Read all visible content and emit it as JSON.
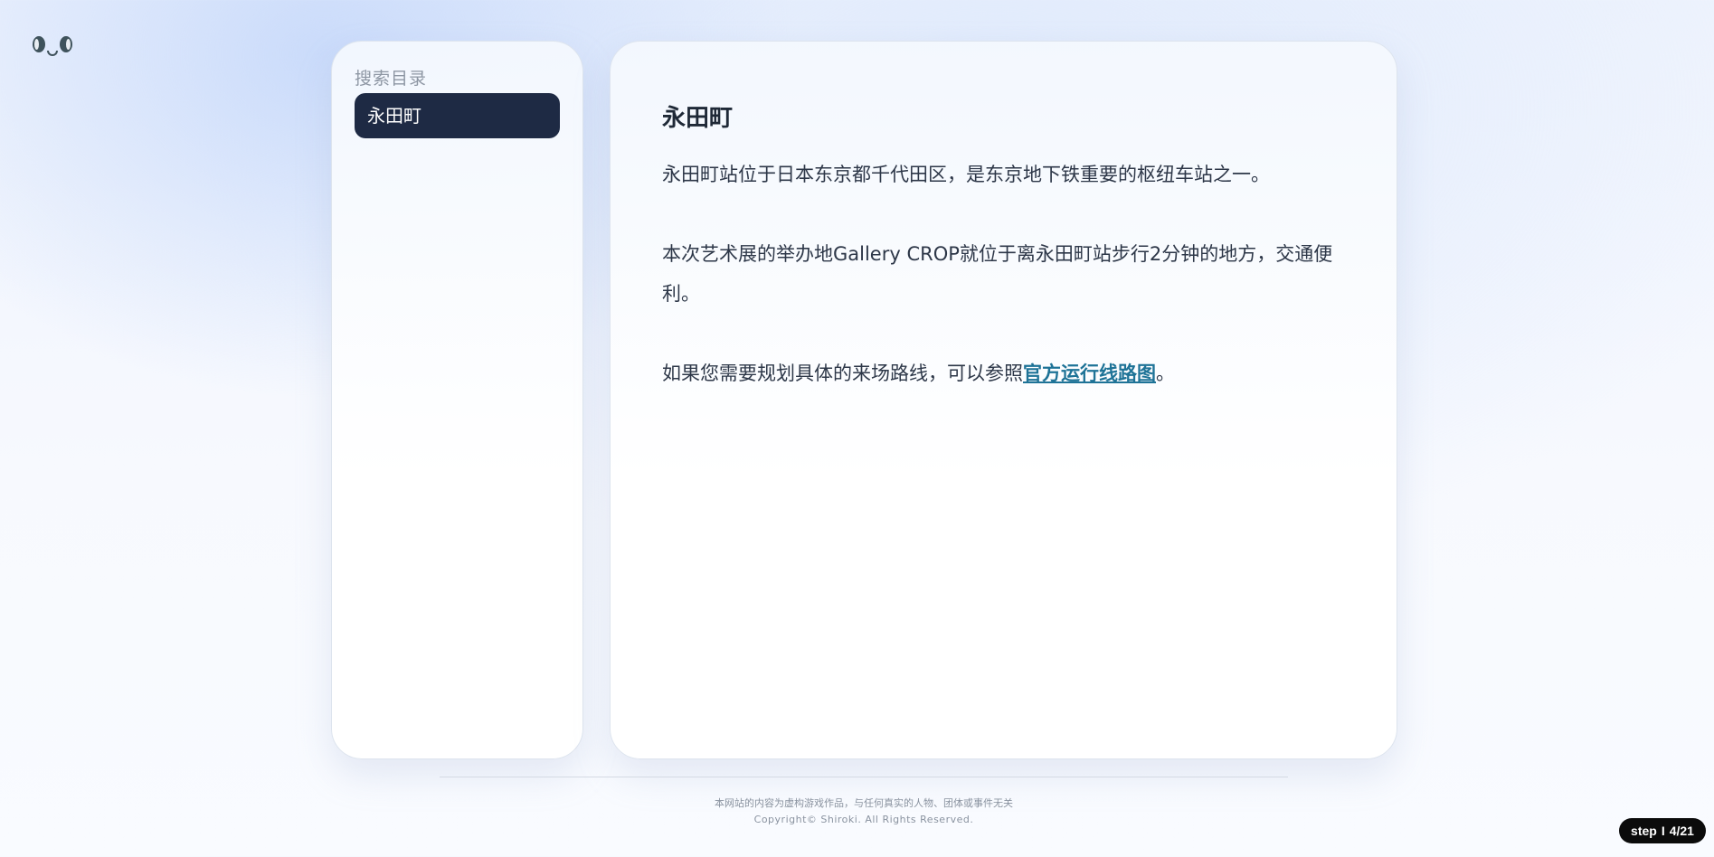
{
  "logo": {
    "icon": "kaomoji-face-icon"
  },
  "sidebar": {
    "title": "搜索目录",
    "items": [
      {
        "label": "永田町",
        "active": true
      }
    ]
  },
  "article": {
    "title": "永田町",
    "paragraphs": [
      "永田町站位于日本东京都千代田区，是东京地下铁重要的枢纽车站之一。",
      "本次艺术展的举办地Gallery CROP就位于离永田町站步行2分钟的地方，交通便利。"
    ],
    "route": {
      "prefix": "如果您需要规划具体的来场路线，可以参照",
      "link_label": "官方运行线路图",
      "suffix": "。"
    }
  },
  "footer": {
    "disclaimer": "本网站的内容为虚构游戏作品，与任何真实的人物、团体或事件无关",
    "copyright": "Copyright© Shiroki. All Rights Reserved."
  },
  "step_badge": {
    "label": "step",
    "separator": "I",
    "progress": "4/21"
  },
  "colors": {
    "active_item_bg": "#1e2a44",
    "link": "#1e7397",
    "badge_bg": "#0b0b0b"
  }
}
